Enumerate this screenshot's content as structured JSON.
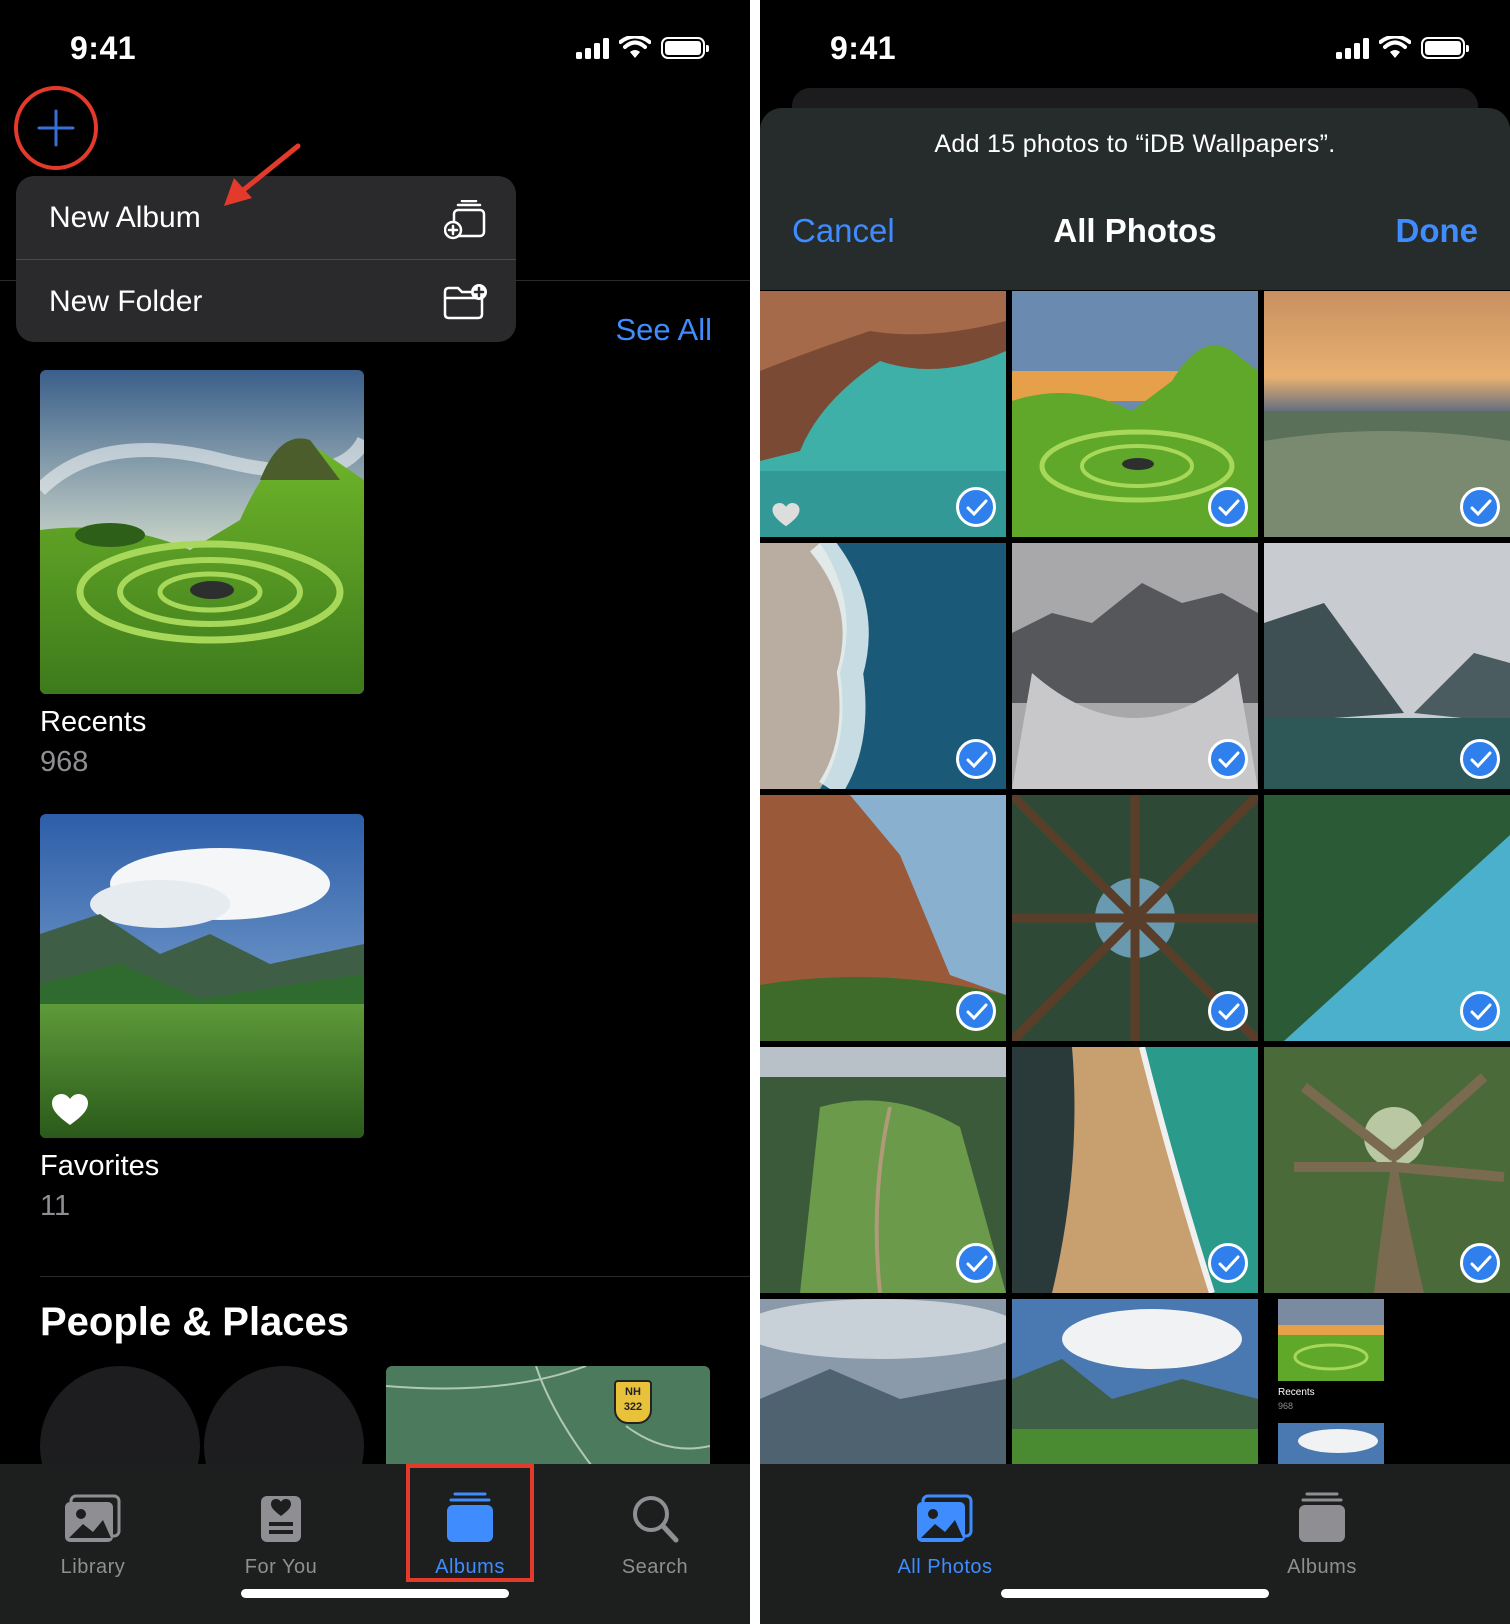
{
  "left": {
    "status": {
      "time": "9:41"
    },
    "menu": {
      "new_album": "New Album",
      "new_folder": "New Folder"
    },
    "see_all": "See All",
    "albums": [
      {
        "name": "Recents",
        "count": "968"
      },
      {
        "name": "Favorites",
        "count": "11"
      }
    ],
    "people_places_title": "People & Places",
    "map_badge": {
      "top": "NH",
      "bottom": "322"
    },
    "tabs": [
      {
        "label": "Library",
        "icon": "photo-stack-icon"
      },
      {
        "label": "For You",
        "icon": "for-you-icon"
      },
      {
        "label": "Albums",
        "icon": "albums-icon",
        "active": true
      },
      {
        "label": "Search",
        "icon": "search-icon"
      }
    ]
  },
  "right": {
    "status": {
      "time": "9:41"
    },
    "prompt": "Add 15 photos to “iDB Wallpapers”.",
    "nav": {
      "cancel": "Cancel",
      "title": "All Photos",
      "done": "Done"
    },
    "mini_screenshot": {
      "album": "Recents",
      "count": "968"
    },
    "tabs": [
      {
        "label": "All Photos",
        "icon": "photos-icon",
        "active": true
      },
      {
        "label": "Albums",
        "icon": "albums-icon"
      }
    ]
  },
  "colors": {
    "accent": "#3f8cff",
    "highlight": "#e33a2c",
    "check": "#2f80ed"
  }
}
